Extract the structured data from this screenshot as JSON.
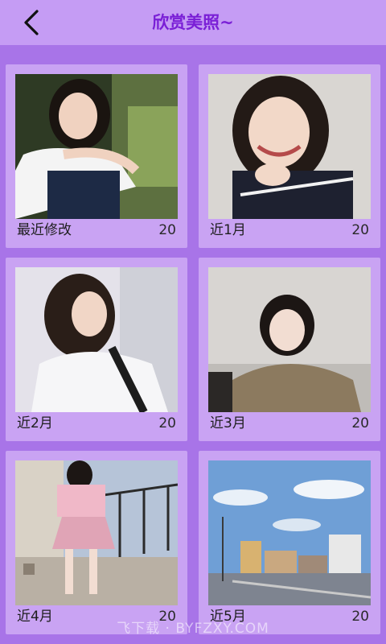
{
  "header": {
    "title": "欣赏美照~",
    "back_icon": "chevron-left-icon"
  },
  "albums": [
    {
      "label": "最近修改",
      "count": "20"
    },
    {
      "label": "近1月",
      "count": "20"
    },
    {
      "label": "近2月",
      "count": "20"
    },
    {
      "label": "近3月",
      "count": "20"
    },
    {
      "label": "近4月",
      "count": "20"
    },
    {
      "label": "近5月",
      "count": "20"
    }
  ],
  "watermark": "飞下载 · BYFZXY.COM",
  "colors": {
    "background": "#a874e8",
    "header": "#c59cf4",
    "card": "#c9a3f3",
    "title": "#7a1fd6"
  }
}
